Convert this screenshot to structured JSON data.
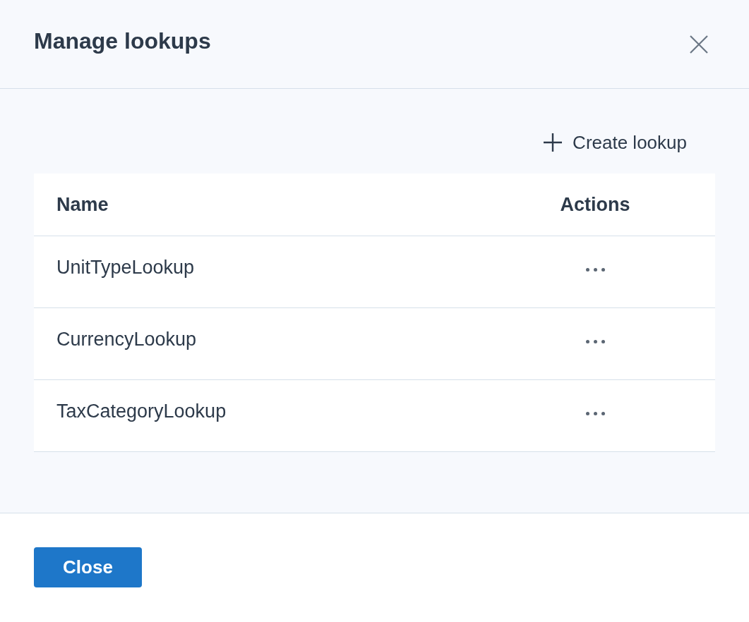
{
  "dialog": {
    "title": "Manage lookups"
  },
  "create_button": {
    "label": "Create lookup"
  },
  "table": {
    "columns": [
      "Name",
      "Actions"
    ],
    "rows": [
      {
        "name": "UnitTypeLookup"
      },
      {
        "name": "CurrencyLookup"
      },
      {
        "name": "TaxCategoryLookup"
      }
    ]
  },
  "footer": {
    "button": "Close"
  }
}
